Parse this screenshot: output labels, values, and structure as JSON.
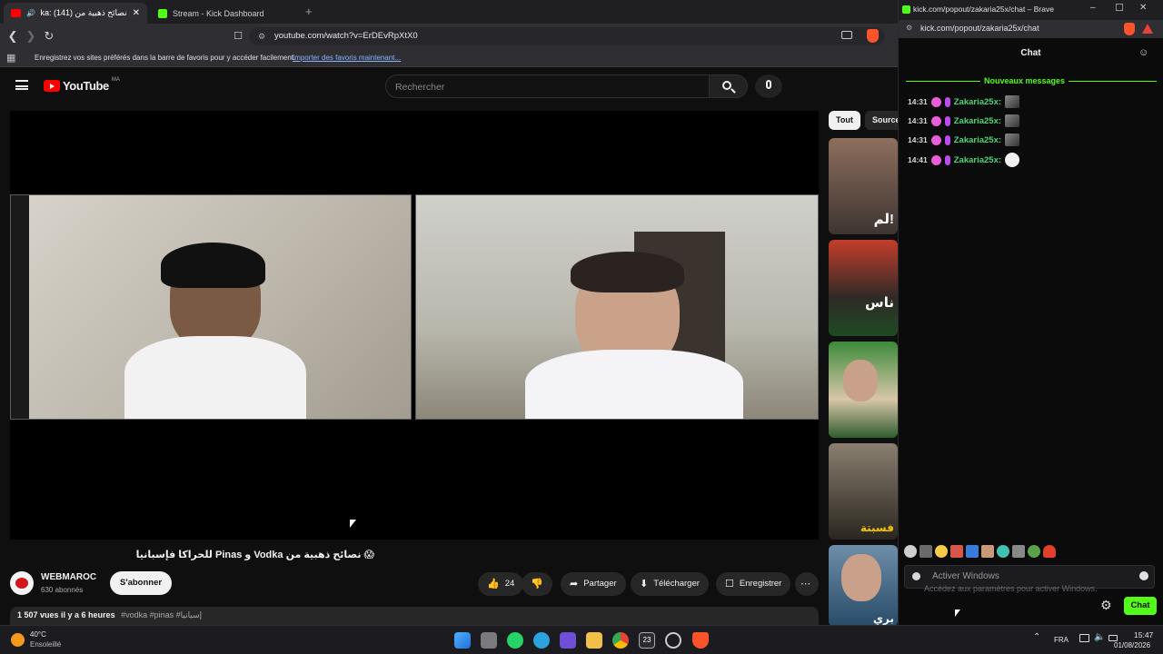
{
  "tabs": [
    {
      "label": "نصائح ذهبية من (141) :dka 😱"
    },
    {
      "label": "Stream - Kick Dashboard"
    }
  ],
  "address": {
    "url": "youtube.com/watch?v=ErDEvRpXtX0"
  },
  "bookmarks": {
    "text": "Enregistrez vos sites préférés dans la barre de favoris pour y accéder facilement.",
    "link": "Importer des favoris maintenant..."
  },
  "youtube": {
    "logo": "YouTube",
    "region": "MA",
    "search_placeholder": "Rechercher",
    "chips": [
      "Tout",
      "Source"
    ],
    "video_title": "😱 نصائح ذهبية من Vodka و Pinas للحراكا فإسبانيا",
    "channel_name": "WEBMAROC",
    "subscribers": "630 abonnés",
    "subscribe": "S'abonner",
    "likes": "24",
    "share": "Partager",
    "download": "Télécharger",
    "save": "Enregistrer",
    "views_line": "1 507 vues  il y a 6 heures",
    "tags": "#vodka #pinas #إسبانيا",
    "thumb_texts": [
      "لم!",
      "ناس",
      "",
      "فسبتة",
      "بري"
    ]
  },
  "kick": {
    "window_title": "kick.com/popout/zakaria25x/chat – Brave",
    "url": "kick.com/popout/zakaria25x/chat",
    "header": "Chat",
    "new_messages": "Nouveaux messages",
    "messages": [
      {
        "time": "14:31",
        "user": "Zakaria25x:"
      },
      {
        "time": "14:31",
        "user": "Zakaria25x:"
      },
      {
        "time": "14:31",
        "user": "Zakaria25x:"
      },
      {
        "time": "14:41",
        "user": "Zakaria25x:"
      }
    ],
    "input_placeholder": "Activer Windows",
    "watermark_title": "Activer Windows",
    "watermark_sub": "Accédez aux paramètres pour activer Windows.",
    "chat_button": "Chat",
    "accent": "#53fc18",
    "username_color": "#4bd67a"
  },
  "taskbar": {
    "temp": "40°C",
    "weather": "Ensoleillé",
    "lang": "FRA",
    "time": "15:47",
    "date": "01/08/2026",
    "calendar_badge": "23"
  }
}
